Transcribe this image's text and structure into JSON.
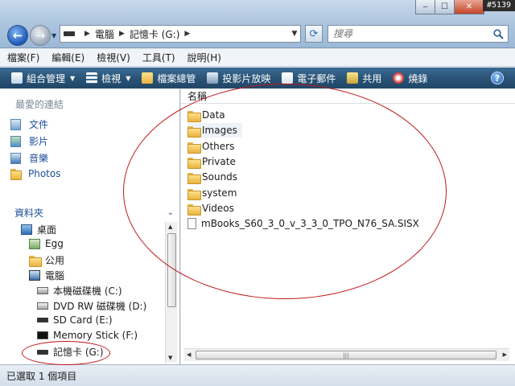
{
  "watermark": "#5139",
  "window_buttons": {
    "minimize": "‒",
    "maximize": "☐",
    "close": "✕"
  },
  "address": {
    "crumbs": [
      "電腦",
      "記憶卡 (G:)"
    ]
  },
  "search": {
    "placeholder": "搜尋"
  },
  "menubar": [
    "檔案(F)",
    "編輯(E)",
    "檢視(V)",
    "工具(T)",
    "說明(H)"
  ],
  "cmdbar": [
    {
      "label": "組合管理",
      "icon": "organize-icon",
      "dropdown": true
    },
    {
      "label": "檢視",
      "icon": "views-icon",
      "dropdown": true
    },
    {
      "label": "檔案總管",
      "icon": "explorer-icon",
      "dropdown": false
    },
    {
      "label": "投影片放映",
      "icon": "slideshow-icon",
      "dropdown": false
    },
    {
      "label": "電子郵件",
      "icon": "email-icon",
      "dropdown": false
    },
    {
      "label": "共用",
      "icon": "share-icon",
      "dropdown": false
    },
    {
      "label": "燒錄",
      "icon": "burn-icon",
      "dropdown": false
    }
  ],
  "favorites": {
    "title": "最愛的連結",
    "items": [
      "文件",
      "影片",
      "音樂",
      "Photos"
    ]
  },
  "folders": {
    "title": "資料夾",
    "tree": [
      {
        "label": "桌面",
        "icon": "desktop-icon"
      },
      {
        "label": "Egg",
        "icon": "user-folder-icon"
      },
      {
        "label": "公用",
        "icon": "folder-icon"
      },
      {
        "label": "電腦",
        "icon": "computer-icon"
      },
      {
        "label": "本機磁碟機 (C:)",
        "icon": "hard-drive-icon"
      },
      {
        "label": "DVD RW 磁碟機 (D:)",
        "icon": "dvd-drive-icon"
      },
      {
        "label": "SD Card (E:)",
        "icon": "card-drive-icon"
      },
      {
        "label": "Memory Stick (F:)",
        "icon": "memory-stick-icon"
      },
      {
        "label": "記憶卡 (G:)",
        "icon": "card-drive-icon"
      }
    ]
  },
  "filelist": {
    "column_name": "名稱",
    "items": [
      {
        "name": "Data",
        "type": "folder"
      },
      {
        "name": "Images",
        "type": "folder",
        "selected": true
      },
      {
        "name": "Others",
        "type": "folder"
      },
      {
        "name": "Private",
        "type": "folder"
      },
      {
        "name": "Sounds",
        "type": "folder"
      },
      {
        "name": "system",
        "type": "folder"
      },
      {
        "name": "Videos",
        "type": "folder"
      },
      {
        "name": "mBooks_S60_3_0_v_3_3_0_TPO_N76_SA.SISX",
        "type": "file"
      }
    ]
  },
  "status": "已選取 1 個項目",
  "colors": {
    "annotation": "#c0151b",
    "command_bar": "#2a5478",
    "link_text": "#1c4e9a"
  }
}
